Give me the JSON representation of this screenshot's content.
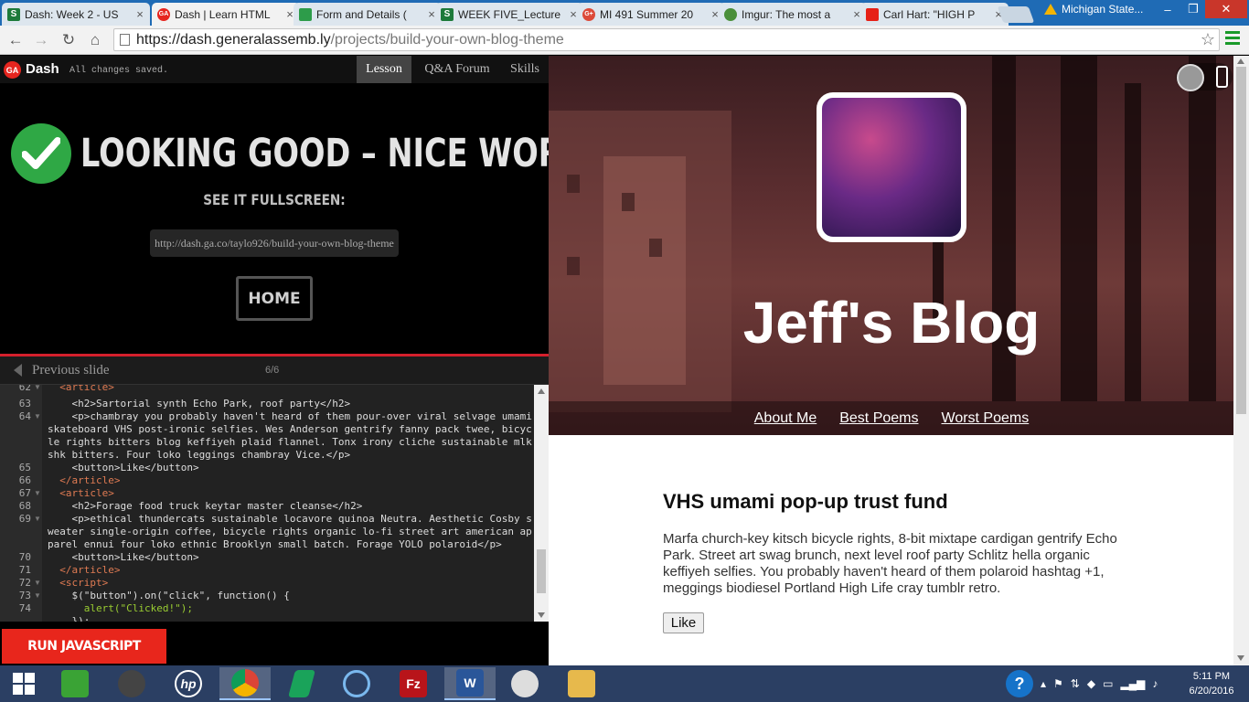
{
  "browser": {
    "tabs": [
      {
        "title": "Dash: Week 2 - US",
        "fav_letter": "S",
        "fav_color": "#1d7a3a"
      },
      {
        "title": "Dash | Learn HTML",
        "fav_letter": "GA",
        "fav_color": "#e6251f"
      },
      {
        "title": "Form and Details (",
        "fav_letter": "",
        "fav_color": "#2d9c4a"
      },
      {
        "title": "WEEK FIVE_Lecture",
        "fav_letter": "S",
        "fav_color": "#1d7a3a"
      },
      {
        "title": "MI 491 Summer 20",
        "fav_letter": "G+",
        "fav_color": "#dc4a38"
      },
      {
        "title": "Imgur: The most a",
        "fav_letter": "",
        "fav_color": "#4a8f3a"
      },
      {
        "title": "Carl Hart: \"HIGH P",
        "fav_letter": "",
        "fav_color": "#e62117"
      }
    ],
    "profile": "Michigan State...",
    "url_host": "https://dash.generalassemb.ly",
    "url_path": "/projects/build-your-own-blog-theme",
    "window_buttons": {
      "minimize": "–",
      "restore": "❐",
      "close": "✕"
    }
  },
  "dash": {
    "logo_text": "GA",
    "title": "Dash",
    "save_status": "All changes saved.",
    "tabs": [
      "Lesson",
      "Q&A Forum",
      "Skills"
    ],
    "success_heading": "LOOKING GOOD – NICE WORK!",
    "fullscreen_label": "SEE IT FULLSCREEN:",
    "fullscreen_url": "http://dash.ga.co/taylo926/build-your-own-blog-theme",
    "home_label": "HOME",
    "prev_slide": "Previous slide",
    "slide_counter": "6/6",
    "run_label": "RUN JAVASCRIPT"
  },
  "code": {
    "line_numbers": [
      "62",
      "63",
      "64",
      "",
      "",
      "",
      "65",
      "66",
      "67",
      "68",
      "69",
      "",
      "",
      "70",
      "71",
      "72",
      "73",
      "74"
    ],
    "lines": [
      "  <article>",
      "    <h2>Sartorial synth Echo Park, roof party</h2>",
      "    <p>chambray you probably haven't heard of them pour-over viral selvage umami skateboard VHS post-ironic selfies. Wes Anderson gentrify fanny pack twee, bicycle rights bitters blog keffiyeh plaid flannel. Tonx irony cliche sustainable mlkshk bitters. Four loko leggings chambray Vice.</p>",
      "    <button>Like</button>",
      "  </article>",
      "  <article>",
      "    <h2>Forage food truck keytar master cleanse</h2>",
      "    <p>ethical thundercats sustainable locavore quinoa Neutra. Aesthetic Cosby sweater single-origin coffee, bicycle rights organic lo-fi street art american apparel ennui four loko ethnic Brooklyn small batch. Forage YOLO polaroid</p>",
      "    <button>Like</button>",
      "  </article>",
      "  <script>",
      "    $(\"button\").on(\"click\", function() {",
      "      alert(\"Clicked!\");",
      "    });"
    ]
  },
  "preview": {
    "blog_title": "Jeff's Blog",
    "nav": [
      "About Me",
      "Best Poems",
      "Worst Poems"
    ],
    "post_title": "VHS umami pop-up trust fund",
    "post_body": "Marfa church-key kitsch bicycle rights, 8-bit mixtape cardigan gentrify Echo Park. Street art swag brunch, next level roof party Schlitz hella organic keffiyeh selfies. You probably haven't heard of them polaroid hashtag +1, meggings biodiesel Portland High Life cray tumblr retro.",
    "like_label": "Like"
  },
  "taskbar": {
    "apps": [
      {
        "name": "windows-start",
        "glyph": "",
        "color": "#2b3f63"
      },
      {
        "name": "store-app",
        "glyph": "",
        "color": "#3aa335"
      },
      {
        "name": "webcam-app",
        "glyph": "",
        "color": "#333"
      },
      {
        "name": "hp-app",
        "glyph": "hp",
        "color": "#2b3f63"
      },
      {
        "name": "chrome-app",
        "glyph": "",
        "color": "#2b3f63"
      },
      {
        "name": "green-app",
        "glyph": "",
        "color": "#2b3f63"
      },
      {
        "name": "browser-app",
        "glyph": "",
        "color": "#2b3f63"
      },
      {
        "name": "filezilla-app",
        "glyph": "Fz",
        "color": "#b8141a"
      },
      {
        "name": "word-app",
        "glyph": "W",
        "color": "#2a5699"
      },
      {
        "name": "zbrush-app",
        "glyph": "",
        "color": "#2b3f63"
      },
      {
        "name": "explorer-app",
        "glyph": "",
        "color": "#e7b94c"
      }
    ],
    "help": "?",
    "time": "5:11 PM",
    "date": "6/20/2016"
  }
}
